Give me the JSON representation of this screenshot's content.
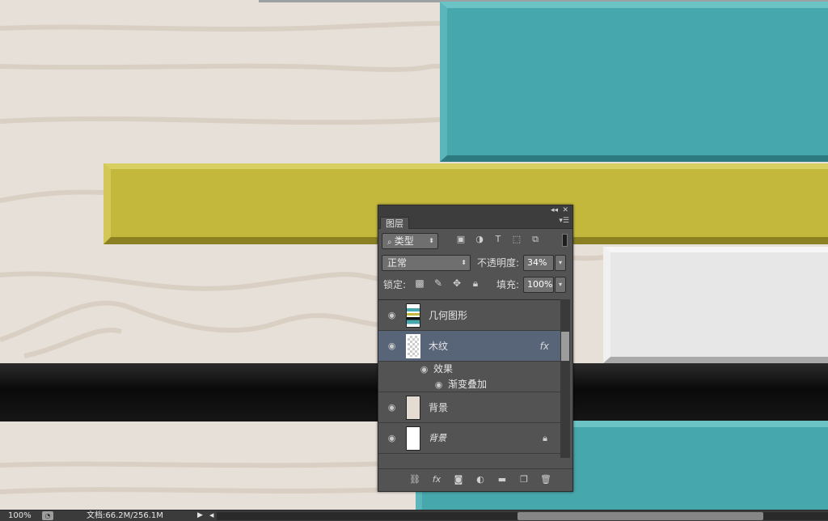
{
  "panel": {
    "title": "图层",
    "filter": {
      "kind_label": "类型"
    },
    "blend_mode": "正常",
    "opacity_label": "不透明度:",
    "opacity_value": "34%",
    "lock_label": "锁定:",
    "fill_label": "填充:",
    "fill_value": "100%",
    "layers": [
      {
        "name": "几何图形",
        "visible": true
      },
      {
        "name": "木纹",
        "visible": true,
        "selected": true,
        "fx": "fx",
        "effects_label": "效果",
        "effect_item": "渐变叠加"
      },
      {
        "name": "背景",
        "visible": true
      },
      {
        "name": "背景",
        "visible": true,
        "locked": true
      }
    ]
  },
  "statusbar": {
    "zoom": "100%",
    "doc_info": "文档:66.2M/256.1M"
  },
  "colors": {
    "teal": "#46a7ac",
    "yellow": "#c4b83c",
    "panel_bg": "#535353",
    "selected_layer": "#586478"
  }
}
